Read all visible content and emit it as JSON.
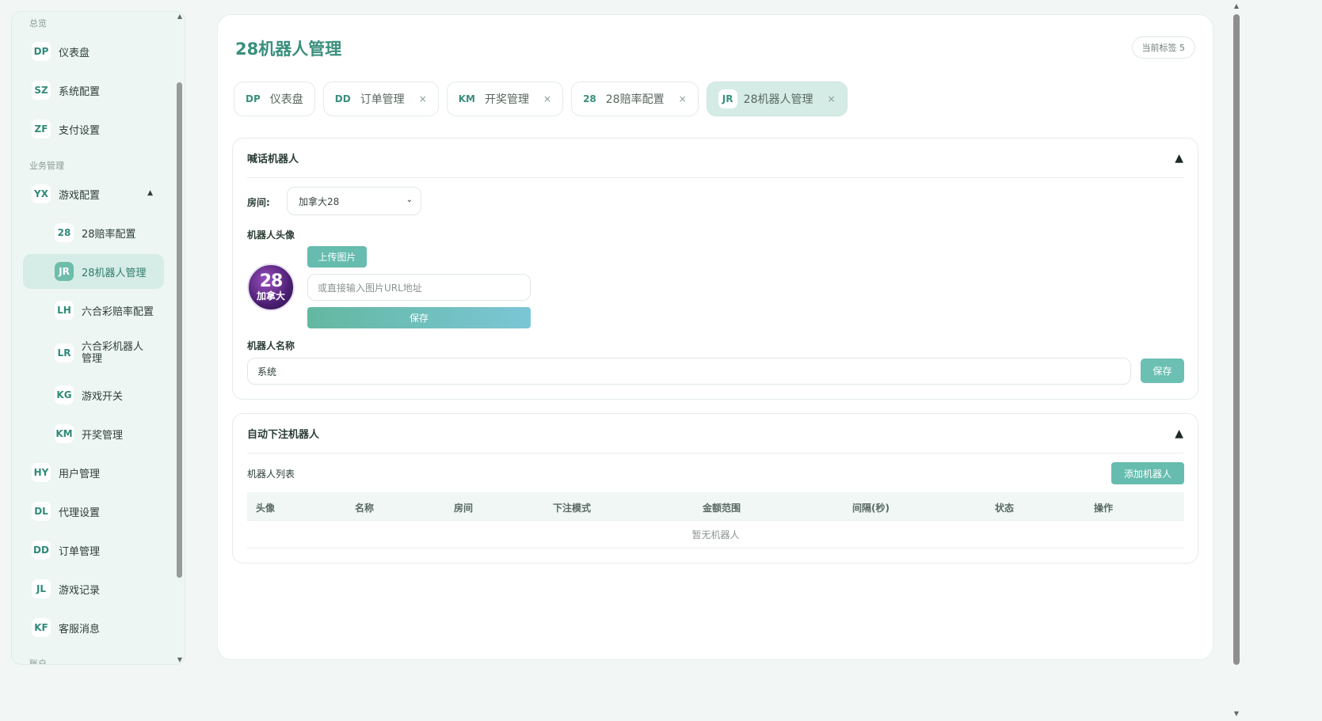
{
  "sidebar": {
    "sections": {
      "overview": "总览",
      "business": "业务管理",
      "account": "账户"
    },
    "items": [
      {
        "badge": "DP",
        "label": "仪表盘"
      },
      {
        "badge": "SZ",
        "label": "系统配置"
      },
      {
        "badge": "ZF",
        "label": "支付设置"
      },
      {
        "badge": "YX",
        "label": "游戏配置"
      },
      {
        "badge": "28",
        "label": "28赔率配置"
      },
      {
        "badge": "JR",
        "label": "28机器人管理"
      },
      {
        "badge": "LH",
        "label": "六合彩赔率配置"
      },
      {
        "badge": "LR",
        "label": "六合彩机器人管理"
      },
      {
        "badge": "KG",
        "label": "游戏开关"
      },
      {
        "badge": "KM",
        "label": "开奖管理"
      },
      {
        "badge": "HY",
        "label": "用户管理"
      },
      {
        "badge": "DL",
        "label": "代理设置"
      },
      {
        "badge": "DD",
        "label": "订单管理"
      },
      {
        "badge": "JL",
        "label": "游戏记录"
      },
      {
        "badge": "KF",
        "label": "客服消息"
      }
    ],
    "expand_icon": "caret-up-icon"
  },
  "header": {
    "title": "28机器人管理",
    "tag_count": "当前标签 5"
  },
  "tabs": [
    {
      "badge": "DP",
      "label": "仪表盘",
      "closable": false
    },
    {
      "badge": "DD",
      "label": "订单管理",
      "closable": true
    },
    {
      "badge": "KM",
      "label": "开奖管理",
      "closable": true
    },
    {
      "badge": "28",
      "label": "28赔率配置",
      "closable": true
    },
    {
      "badge": "JR",
      "label": "28机器人管理",
      "closable": true
    }
  ],
  "tab_close_glyph": "×",
  "shout_bot": {
    "title": "喊话机器人",
    "toggle": "▲",
    "room_label": "房间:",
    "room_value": "加拿大28",
    "avatar_label": "机器人头像",
    "avatar_text_1": "28",
    "avatar_text_2": "加拿大",
    "upload_button": "上传图片",
    "url_placeholder": "或直接输入图片URL地址",
    "save_avatar_button": "保存",
    "name_label": "机器人名称",
    "name_value": "系统",
    "save_name_button": "保存"
  },
  "auto_bet_bot": {
    "title": "自动下注机器人",
    "toggle": "▲",
    "list_label": "机器人列表",
    "add_button": "添加机器人",
    "columns": [
      "头像",
      "名称",
      "房间",
      "下注模式",
      "金额范围",
      "间隔(秒)",
      "状态",
      "操作"
    ],
    "empty_text": "暂无机器人"
  },
  "colors": {
    "accent": "#3a8f7d",
    "button": "#66bcae",
    "active_bg": "#d6ece6"
  }
}
